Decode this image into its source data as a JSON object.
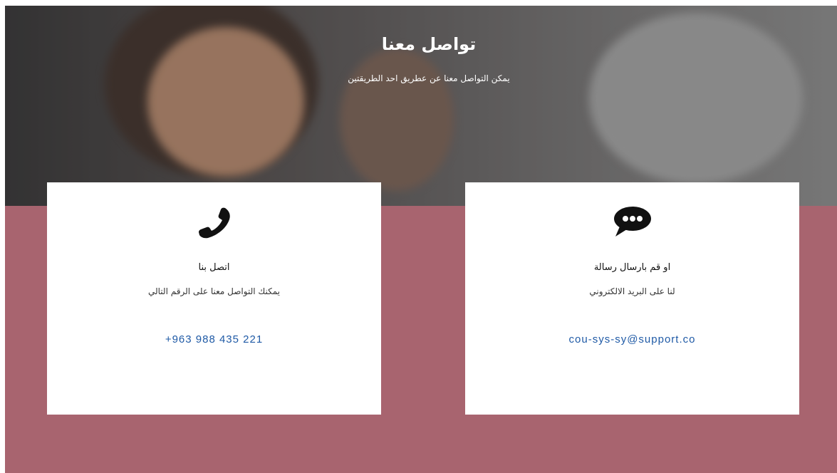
{
  "hero": {
    "title": "تواصل معنا",
    "subtitle": "يمكن التواصل معنا عن عطريق احد الطريقتين"
  },
  "cards": [
    {
      "icon": "phone-icon",
      "heading": "اتصل بنا",
      "description": "يمكنك التواصل معنا على الرقم التالي",
      "contact": "+963 988 435 221"
    },
    {
      "icon": "chat-bubble-icon",
      "heading": "او قم بارسال رسالة",
      "description": "لنا على البريد الالكتروني",
      "contact": "cou-sys-sy@support.co"
    }
  ],
  "colors": {
    "band": "#a8646f",
    "card": "#ffffff",
    "link": "#1f5aa6",
    "hero_overlay": "#5a5656"
  }
}
